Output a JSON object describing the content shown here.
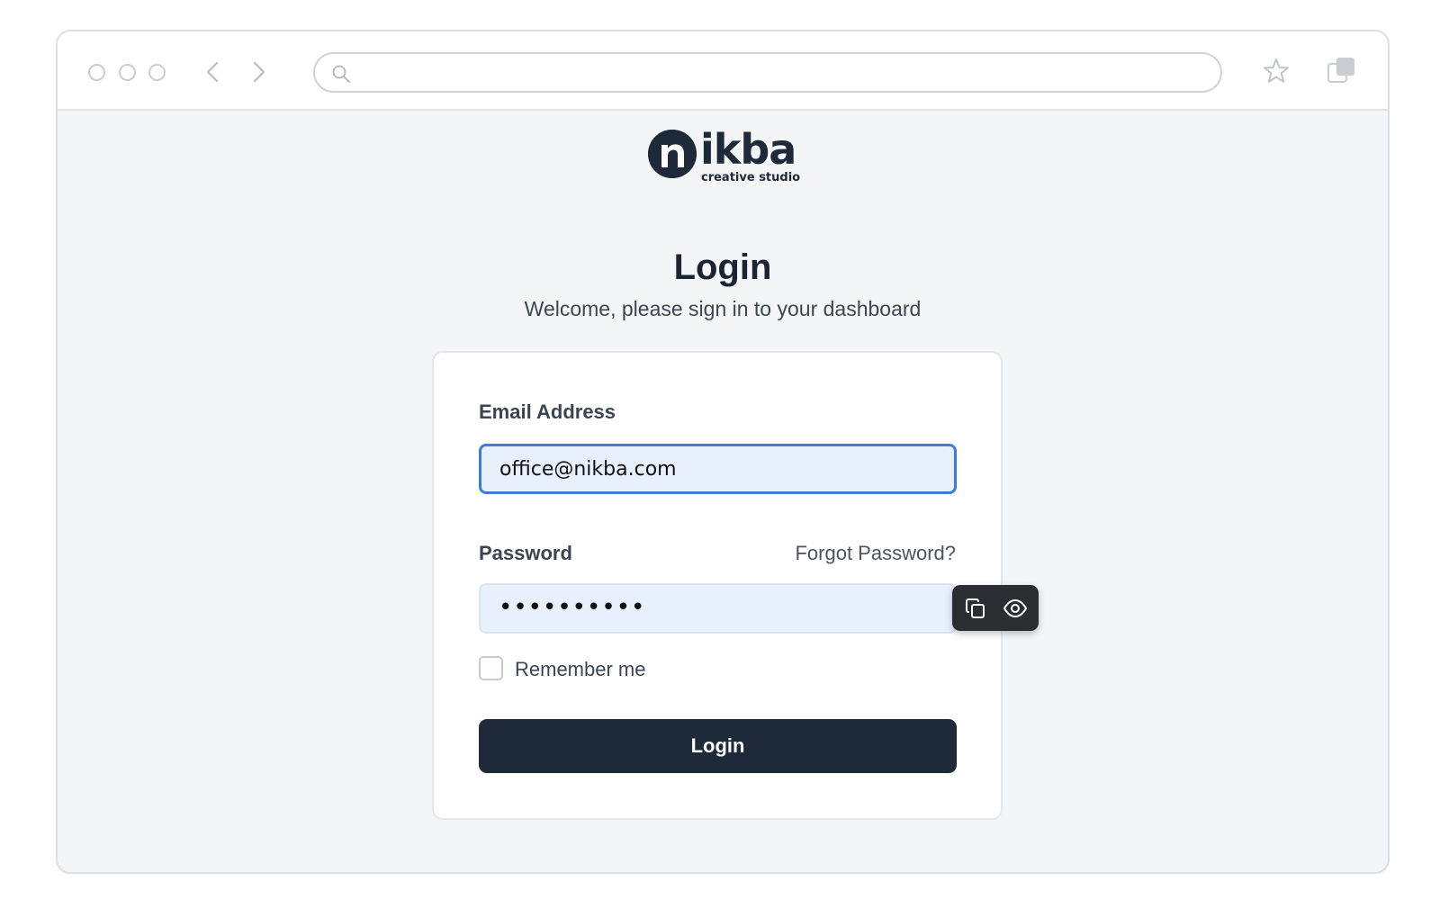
{
  "brand": {
    "name": "ikba",
    "initial": "n",
    "tagline": "creative studio"
  },
  "page": {
    "title": "Login",
    "subtitle": "Welcome, please sign in to your dashboard"
  },
  "form": {
    "email_label": "Email Address",
    "email_value": "office@nikba.com",
    "password_label": "Password",
    "password_masked": "••••••••••",
    "forgot_link": "Forgot Password?",
    "remember_label": "Remember me",
    "remember_checked": false,
    "login_button": "Login"
  },
  "colors": {
    "primary": "#1e293a",
    "focus_border": "#3b7dd8",
    "input_bg": "#e9f0fd",
    "page_bg": "#f3f5f7"
  },
  "icons": {
    "toolbar": [
      "search-icon",
      "back-icon",
      "forward-icon",
      "star-icon",
      "tabs-icon"
    ],
    "password_popup": [
      "copy-icon",
      "eye-icon"
    ]
  }
}
